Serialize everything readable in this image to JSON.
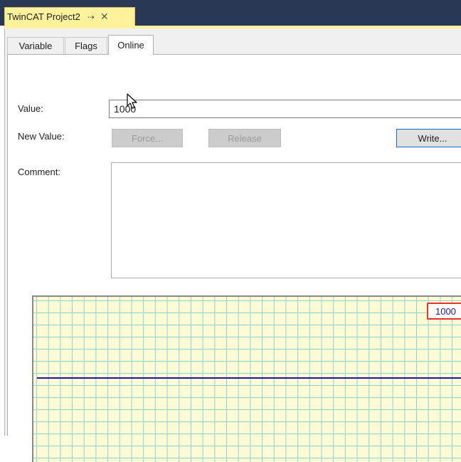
{
  "document_tab": {
    "title": "TwinCAT Project2",
    "pin_icon": "pin-icon",
    "close_icon": "close-icon",
    "pin_glyph": "→",
    "close_glyph": "✕"
  },
  "property_tabs": [
    {
      "label": "Variable",
      "active": false
    },
    {
      "label": "Flags",
      "active": false
    },
    {
      "label": "Online",
      "active": true
    }
  ],
  "online": {
    "value_label": "Value:",
    "value": "1000",
    "new_value_label": "New Value:",
    "force_label": "Force...",
    "release_label": "Release",
    "write_label": "Write...",
    "comment_label": "Comment:",
    "comment_value": ""
  },
  "chart": {
    "readout": "1000",
    "readout_value": 1000,
    "line_color": "#1c14a8",
    "highlight_color": "#e8322e",
    "background_color": "#fcfbd6",
    "grid_color": "#8fd3cf"
  },
  "colors": {
    "tabstrip": "#293955",
    "active_doc_tab": "#fff29d",
    "write_button_border": "#0f6fc6"
  }
}
